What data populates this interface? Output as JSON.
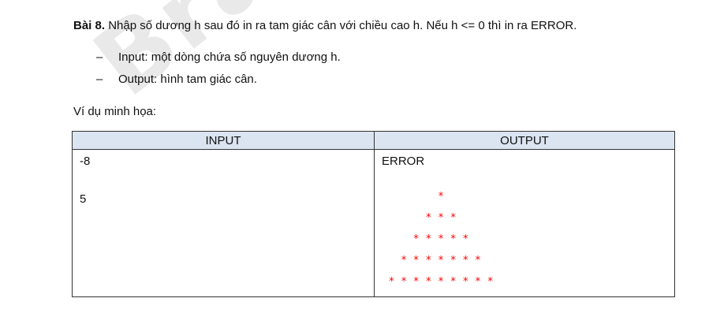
{
  "watermark": "Braniumn",
  "problem": {
    "title": "Bài 8.",
    "text": " Nhập số dương h sau đó in ra tam giác cân với chiều cao h. Nếu h <= 0 thì in ra ERROR."
  },
  "bullets": [
    {
      "dash": "–",
      "text": "Input: một dòng chứa số nguyên dương h."
    },
    {
      "dash": "–",
      "text": "Output: hình tam giác cân."
    }
  ],
  "example_label": "Ví dụ minh họa:",
  "table": {
    "headers": [
      "INPUT",
      "OUTPUT"
    ],
    "inputs": [
      "-8",
      "5"
    ],
    "output_error": "ERROR",
    "triangle_rows": [
      "*",
      "* * *",
      "* * * * *",
      "* * * * * * *",
      "* * * * * * * * *"
    ]
  },
  "colors": {
    "header_bg": "#dbe5f1",
    "star": "#ff0000"
  }
}
